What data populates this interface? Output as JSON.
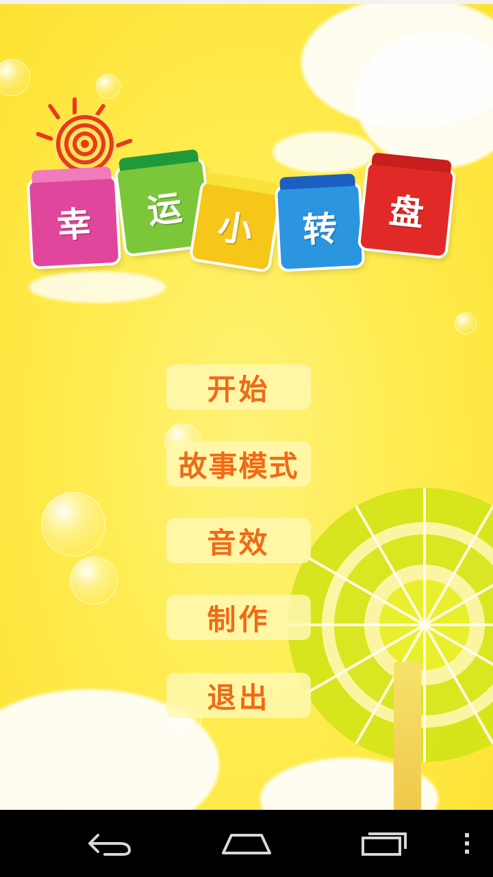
{
  "title": {
    "chars": [
      "幸",
      "运",
      "小",
      "转",
      "盘"
    ],
    "colors": [
      "#e0479c",
      "#7cc63a",
      "#f6c619",
      "#2b95e0",
      "#e12a27"
    ]
  },
  "menu": {
    "items": [
      {
        "label": "开始"
      },
      {
        "label": "故事模式"
      },
      {
        "label": "音效"
      },
      {
        "label": "制作"
      },
      {
        "label": "退出"
      }
    ]
  },
  "navbar": {
    "back_icon": "back-arrow-icon",
    "home_icon": "home-icon",
    "recents_icon": "recent-apps-icon",
    "overflow_icon": "more-vertical-icon"
  },
  "colors": {
    "background": "#fde232",
    "menu_text": "#f06a18",
    "menu_bg": "#fff8b0"
  }
}
